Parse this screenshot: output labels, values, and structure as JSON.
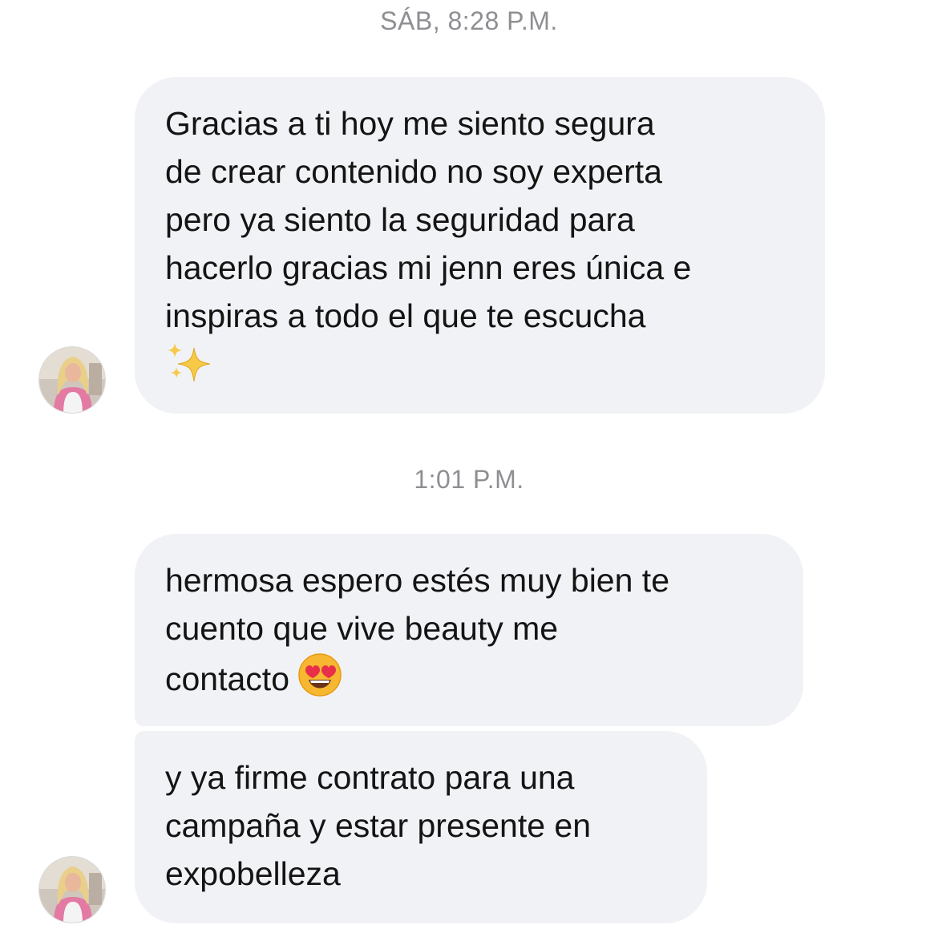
{
  "conversation": {
    "timestamps": {
      "first": "SÁB, 8:28 P.M.",
      "second": "1:01 P.M."
    },
    "messages": [
      {
        "lines": [
          "Gracias a ti hoy me siento segura",
          "de crear contenido no soy experta",
          "pero ya siento la seguridad para",
          "hacerlo gracias mi jenn eres única e",
          "inspiras a todo el que te escucha"
        ],
        "trailing_emoji": "sparkles-emoji"
      },
      {
        "lines": [
          "hermosa espero estés muy bien te",
          "cuento que vive beauty me",
          "contacto"
        ],
        "trailing_emoji": "heart-eyes-emoji"
      },
      {
        "lines": [
          "y ya firme contrato para una",
          "campaña y estar presente en",
          "expobelleza"
        ]
      }
    ]
  },
  "colors": {
    "bubble_background": "#f1f2f5",
    "timestamp_text": "#8e8e93",
    "message_text": "#141414"
  }
}
